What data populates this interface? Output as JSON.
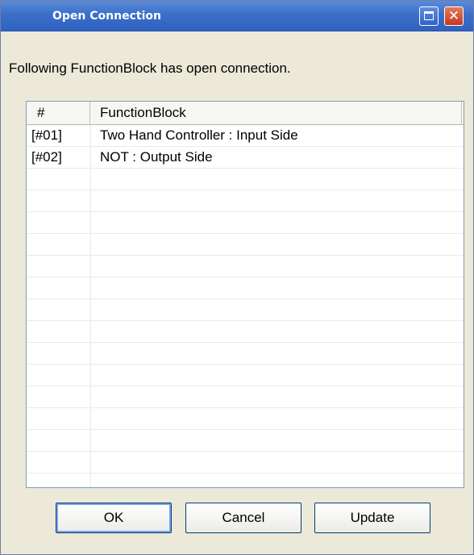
{
  "window": {
    "title": "Open Connection",
    "maximize_icon": "maximize-icon",
    "close_icon": "close-icon",
    "close_glyph": "✕"
  },
  "message": "Following FunctionBlock has open connection.",
  "list": {
    "columns": [
      "#",
      "FunctionBlock"
    ],
    "rows": [
      {
        "id": "[#01]",
        "block": "Two Hand Controller : Input Side"
      },
      {
        "id": "[#02]",
        "block": "NOT : Output Side"
      },
      {
        "id": "",
        "block": ""
      },
      {
        "id": "",
        "block": ""
      },
      {
        "id": "",
        "block": ""
      },
      {
        "id": "",
        "block": ""
      },
      {
        "id": "",
        "block": ""
      },
      {
        "id": "",
        "block": ""
      },
      {
        "id": "",
        "block": ""
      },
      {
        "id": "",
        "block": ""
      },
      {
        "id": "",
        "block": ""
      },
      {
        "id": "",
        "block": ""
      },
      {
        "id": "",
        "block": ""
      },
      {
        "id": "",
        "block": ""
      },
      {
        "id": "",
        "block": ""
      },
      {
        "id": "",
        "block": ""
      },
      {
        "id": "",
        "block": ""
      }
    ]
  },
  "buttons": {
    "ok": "OK",
    "cancel": "Cancel",
    "update": "Update"
  }
}
